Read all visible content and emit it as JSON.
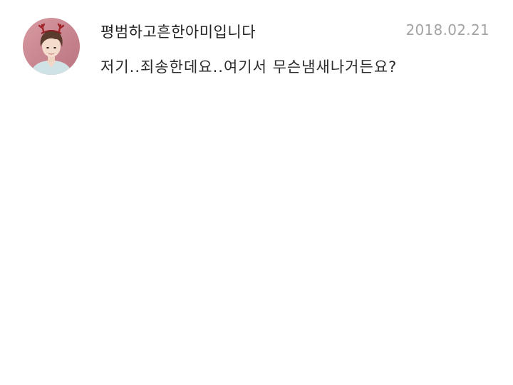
{
  "comment": {
    "avatar_icon": "user-avatar-photo",
    "username": "평범하고흔한아미입니다",
    "date": "2018.02.21",
    "message": "저기..죄송한데요..여기서 무슨냄새나거든요?"
  },
  "colors": {
    "username_text": "#222222",
    "message_text": "#2b2b2b",
    "date_text": "#a3a3a3",
    "avatar_background": "#c98a93",
    "background": "#ffffff"
  }
}
